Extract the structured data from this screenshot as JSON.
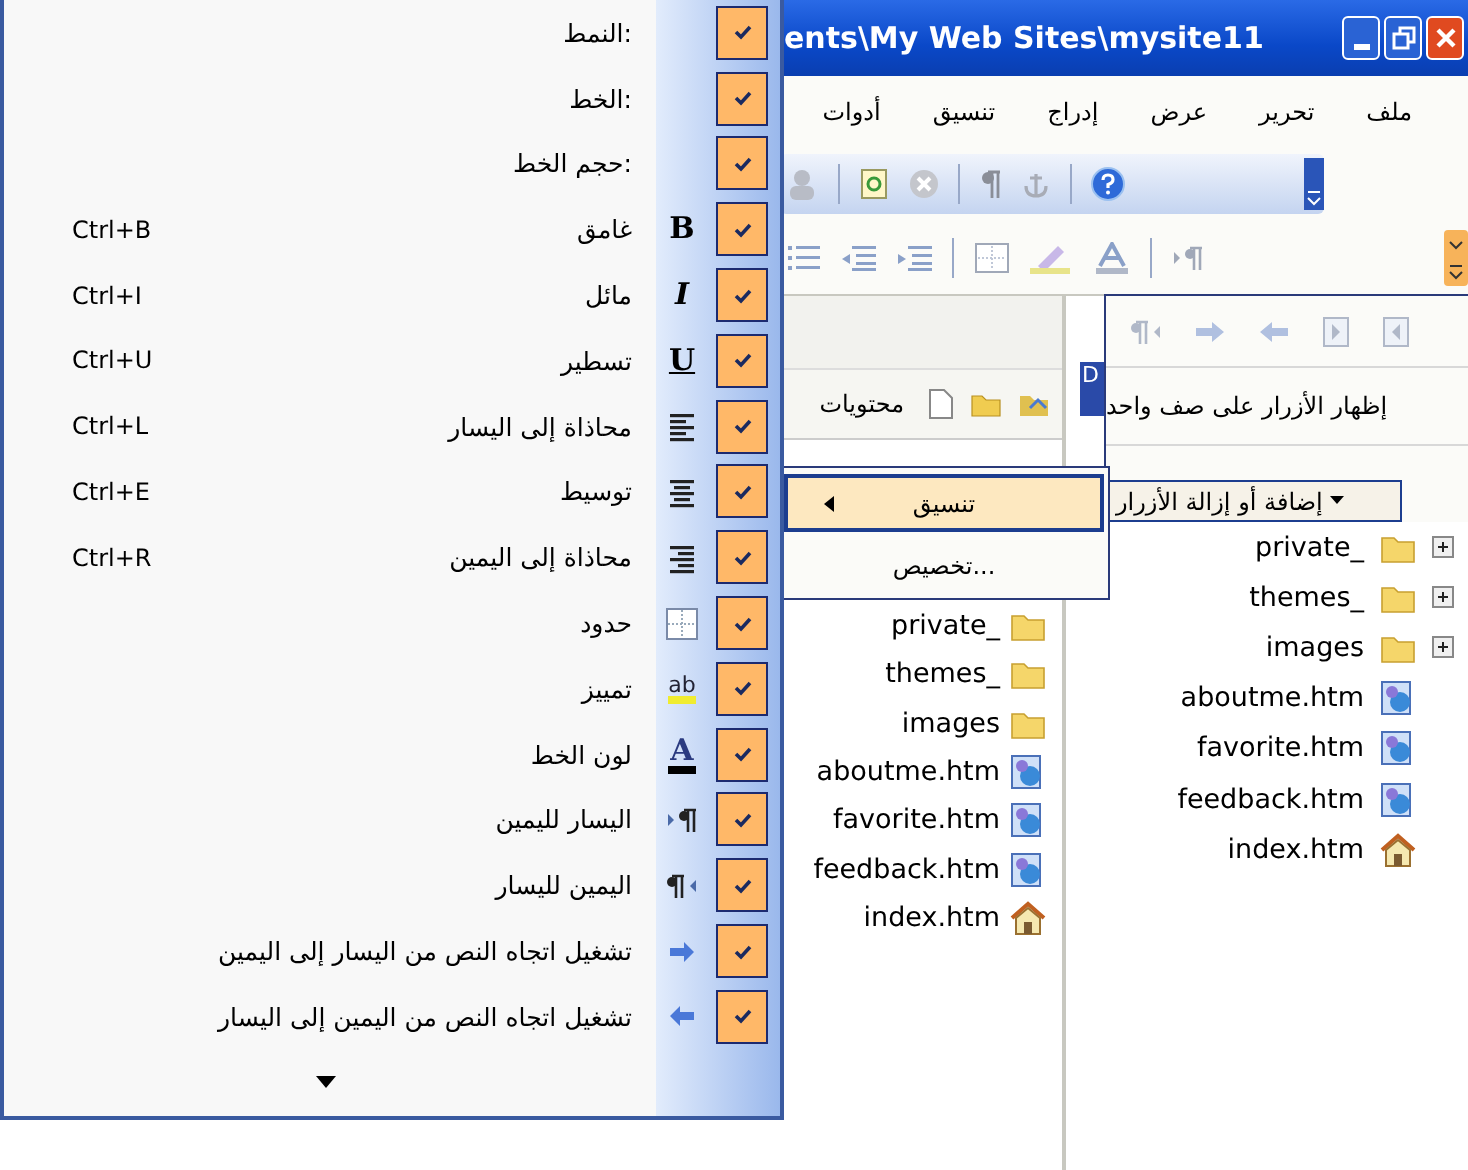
{
  "window": {
    "title": "ents\\My Web Sites\\mysite11"
  },
  "menubar": [
    "ملف",
    "تحرير",
    "عرض",
    "إدراج",
    "تنسيق",
    "أدوات"
  ],
  "folder_pane": {
    "header": "محتويات",
    "items": [
      {
        "label": "private_",
        "kind": "folder"
      },
      {
        "label": "themes_",
        "kind": "folder"
      },
      {
        "label": "images",
        "kind": "folder"
      },
      {
        "label": "aboutme.htm",
        "kind": "page"
      },
      {
        "label": "favorite.htm",
        "kind": "page"
      },
      {
        "label": "feedback.htm",
        "kind": "page"
      },
      {
        "label": "index.htm",
        "kind": "home"
      }
    ]
  },
  "doc_tab": "D",
  "site_pane": {
    "items": [
      {
        "label": "private_",
        "kind": "folder",
        "expandable": true
      },
      {
        "label": "themes_",
        "kind": "folder",
        "expandable": true
      },
      {
        "label": "images",
        "kind": "folder",
        "expandable": true
      },
      {
        "label": "aboutme.htm",
        "kind": "page",
        "expandable": false
      },
      {
        "label": "favorite.htm",
        "kind": "page",
        "expandable": false
      },
      {
        "label": "feedback.htm",
        "kind": "page",
        "expandable": false
      },
      {
        "label": "index.htm",
        "kind": "home",
        "expandable": false
      }
    ]
  },
  "toolbar_options": {
    "one_row": "إظهار الأزرار على صف واحد",
    "add_remove": "إضافة أو إزالة الأزرار"
  },
  "submenu": [
    {
      "label": "تنسيق",
      "selected": true,
      "has_submenu": true
    },
    {
      "label": "تخصيص...",
      "selected": false,
      "has_submenu": false
    }
  ],
  "menu": {
    "items": [
      {
        "label": "النمط:",
        "checked": true
      },
      {
        "label": "الخط:",
        "checked": true
      },
      {
        "label": "حجم الخط:",
        "checked": true
      },
      {
        "label": "غامق",
        "shortcut": "Ctrl+B",
        "checked": true,
        "icon": {
          "kind": "bold",
          "glyph": "B"
        }
      },
      {
        "label": "مائل",
        "shortcut": "Ctrl+I",
        "checked": true,
        "icon": {
          "kind": "italic",
          "glyph": "I"
        }
      },
      {
        "label": "تسطير",
        "shortcut": "Ctrl+U",
        "checked": true,
        "icon": {
          "kind": "underline",
          "glyph": "U"
        }
      },
      {
        "label": "محاذاة إلى اليسار",
        "shortcut": "Ctrl+L",
        "checked": true,
        "icon": {
          "kind": "align-left"
        }
      },
      {
        "label": "توسيط",
        "shortcut": "Ctrl+E",
        "checked": true,
        "icon": {
          "kind": "align-center"
        }
      },
      {
        "label": "محاذاة إلى اليمين",
        "shortcut": "Ctrl+R",
        "checked": true,
        "icon": {
          "kind": "align-right"
        }
      },
      {
        "label": "حدود",
        "checked": true,
        "icon": {
          "kind": "borders"
        }
      },
      {
        "label": "تمييز",
        "checked": true,
        "icon": {
          "kind": "highlight",
          "glyph": "ab"
        }
      },
      {
        "label": "لون الخط",
        "checked": true,
        "icon": {
          "kind": "font-color",
          "glyph": "A"
        }
      },
      {
        "label": "اليسار لليمين",
        "checked": true,
        "icon": {
          "kind": "ltr"
        }
      },
      {
        "label": "اليمين لليسار",
        "checked": true,
        "icon": {
          "kind": "rtl"
        }
      },
      {
        "label": "تشغيل اتجاه النص من اليسار إلى اليمين",
        "checked": true,
        "icon": {
          "kind": "arrow-right"
        }
      },
      {
        "label": "تشغيل اتجاه النص من اليمين إلى اليسار",
        "checked": true,
        "icon": {
          "kind": "arrow-left"
        }
      }
    ]
  }
}
